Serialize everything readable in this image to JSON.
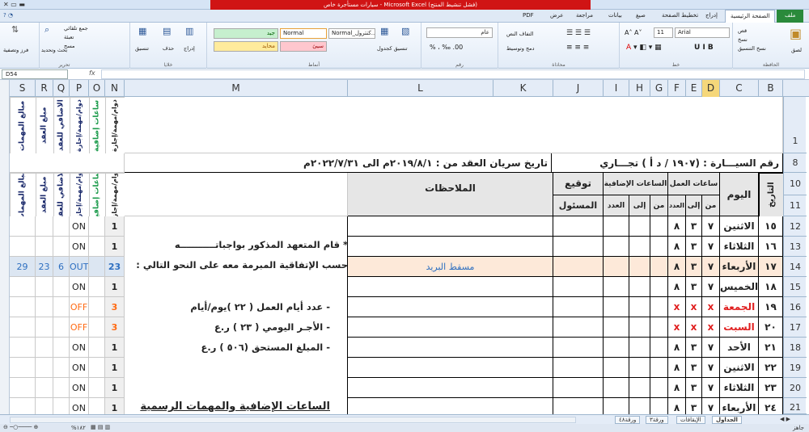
{
  "window": {
    "title": "سيارات مستأجرة خاص - Microsoft Excel (فشل تنشيط المنتج)"
  },
  "ribbon": {
    "tabs": [
      "ملف",
      "الصفحة الرئيسية",
      "إدراج",
      "تخطيط الصفحة",
      "صيغ",
      "بيانات",
      "مراجعة",
      "عرض",
      "PDF"
    ],
    "font_name": "Arial",
    "font_size": "11",
    "number_format": "عام",
    "clipboard": {
      "paste": "لصق",
      "cut": "قص",
      "copy": "نسخ",
      "format_painter": "نسخ التنسيق",
      "label": "الحافظة"
    },
    "font_label": "خط",
    "alignment": {
      "wrap": "التفاف النص",
      "merge": "دمج وتوسيط",
      "label": "محاذاة"
    },
    "number_label": "رقم",
    "styles": {
      "cond_format": "تنسيق شرطي",
      "table_format": "تنسيق كجدول",
      "normal": "Normal",
      "normal_copy": "Normal_كنترول...",
      "good": "جيد",
      "bad": "سيئ",
      "neutral": "محايد",
      "output": "إخراج",
      "label": "أنماط"
    },
    "cells": {
      "insert": "إدراج",
      "delete": "حذف",
      "format": "تنسيق",
      "label": "خلايا"
    },
    "editing": {
      "autosum": "جمع تلقائي",
      "fill": "تعبئة",
      "clear": "مسح",
      "sort": "فرز وتصفية",
      "find": "بحث وتحديد",
      "label": "تحرير"
    }
  },
  "formula_bar": {
    "cell_ref": "D54",
    "fx": "fx",
    "value": ""
  },
  "columns": [
    "B",
    "C",
    "D",
    "E",
    "F",
    "G",
    "H",
    "I",
    "J",
    "K",
    "L",
    "M",
    "N",
    "O",
    "P",
    "Q",
    "R",
    "S"
  ],
  "rows": [
    "1",
    "8",
    "10",
    "11",
    "12",
    "13",
    "14",
    "15",
    "16",
    "17",
    "18",
    "19",
    "20",
    "21"
  ],
  "sheet": {
    "header_right": "رقم السيـــارة : (١٩٠٧ / د أ ) تجـــاري",
    "header_left": "تاريخ سريان العقد من : ٢٠١٩/٨/١م الى ٢٠٢٢/٧/٣١م",
    "col_date": "التاريخ",
    "col_day": "اليوم",
    "col_work_hours": "ساعات العمل",
    "col_overtime": "الساعات الإضافية",
    "col_from": "من",
    "col_to": "إلى",
    "col_count": "العدد",
    "col_signature": "توقيع",
    "col_responsible": "المسئول",
    "col_notes": "الملاحظات",
    "vertical_headers": {
      "N": "دوام/مهمة/إجازة",
      "O": "ساعات إضافية",
      "P": "دوام/مهمة/إجازة",
      "Q": "الاضافي للعقد",
      "R": "مبلغ العقد",
      "S": "مبالغ المهمات"
    },
    "data_rows": [
      {
        "date": "١٥",
        "day": "الاثنين",
        "from": "٧",
        "to": "٣",
        "count": "٨",
        "N": "1",
        "P": "ON",
        "Q": "",
        "R": "",
        "S": "",
        "note": "",
        "day_red": false
      },
      {
        "date": "١٦",
        "day": "الثلاثاء",
        "from": "٧",
        "to": "٣",
        "count": "٨",
        "N": "1",
        "P": "ON",
        "Q": "",
        "R": "",
        "S": "",
        "note": "",
        "day_red": false
      },
      {
        "date": "١٧",
        "day": "الأربعاء",
        "from": "٧",
        "to": "٣",
        "count": "٨",
        "N": "23",
        "P": "OUT",
        "Q": "6",
        "R": "23",
        "S": "29",
        "note": "مسقط البريد",
        "day_red": false
      },
      {
        "date": "١٨",
        "day": "الخميس",
        "from": "٧",
        "to": "٣",
        "count": "٨",
        "N": "1",
        "P": "ON",
        "Q": "",
        "R": "",
        "S": "",
        "note": "",
        "day_red": false
      },
      {
        "date": "١٩",
        "day": "الجمعة",
        "from": "x",
        "to": "x",
        "count": "x",
        "N": "3",
        "P": "OFF",
        "Q": "",
        "R": "",
        "S": "",
        "note": "",
        "day_red": true
      },
      {
        "date": "٢٠",
        "day": "السبت",
        "from": "x",
        "to": "x",
        "count": "x",
        "N": "3",
        "P": "OFF",
        "Q": "",
        "R": "",
        "S": "",
        "note": "",
        "day_red": true
      },
      {
        "date": "٢١",
        "day": "الأحد",
        "from": "٧",
        "to": "٣",
        "count": "٨",
        "N": "1",
        "P": "ON",
        "Q": "",
        "R": "",
        "S": "",
        "note": "",
        "day_red": false
      },
      {
        "date": "٢٢",
        "day": "الاثنين",
        "from": "٧",
        "to": "٣",
        "count": "٨",
        "N": "1",
        "P": "ON",
        "Q": "",
        "R": "",
        "S": "",
        "note": "",
        "day_red": false
      },
      {
        "date": "٢٣",
        "day": "الثلاثاء",
        "from": "٧",
        "to": "٣",
        "count": "٨",
        "N": "1",
        "P": "ON",
        "Q": "",
        "R": "",
        "S": "",
        "note": "",
        "day_red": false
      },
      {
        "date": "٢٤",
        "day": "الأربعاء",
        "from": "٧",
        "to": "٣",
        "count": "٨",
        "N": "1",
        "P": "ON",
        "Q": "",
        "R": "",
        "S": "",
        "note": "",
        "day_red": false
      }
    ],
    "notes_m": {
      "line1": "* قام المتعهد المذكور بواجباتـــــــــــه",
      "line2": "حسب الإتفاقية المبرمة معه على النحو التالي :",
      "line3": "- عدد أيام العمل ( ٢٢ )يوم/أيام",
      "line4": "- الأجـر اليومي ( ٢٣ ) ر.ع",
      "line5": "- المبلغ المستحق (٥٠٦ ) ر.ع",
      "line6": "الساعات الإضافية والمهمات الرسمية"
    }
  },
  "sheet_tabs": [
    "الجداول",
    "الإيقافات",
    "ورقة٣",
    "ورقة٤٨"
  ],
  "status": {
    "ready": "جاهز",
    "zoom": "%١٨٢"
  }
}
